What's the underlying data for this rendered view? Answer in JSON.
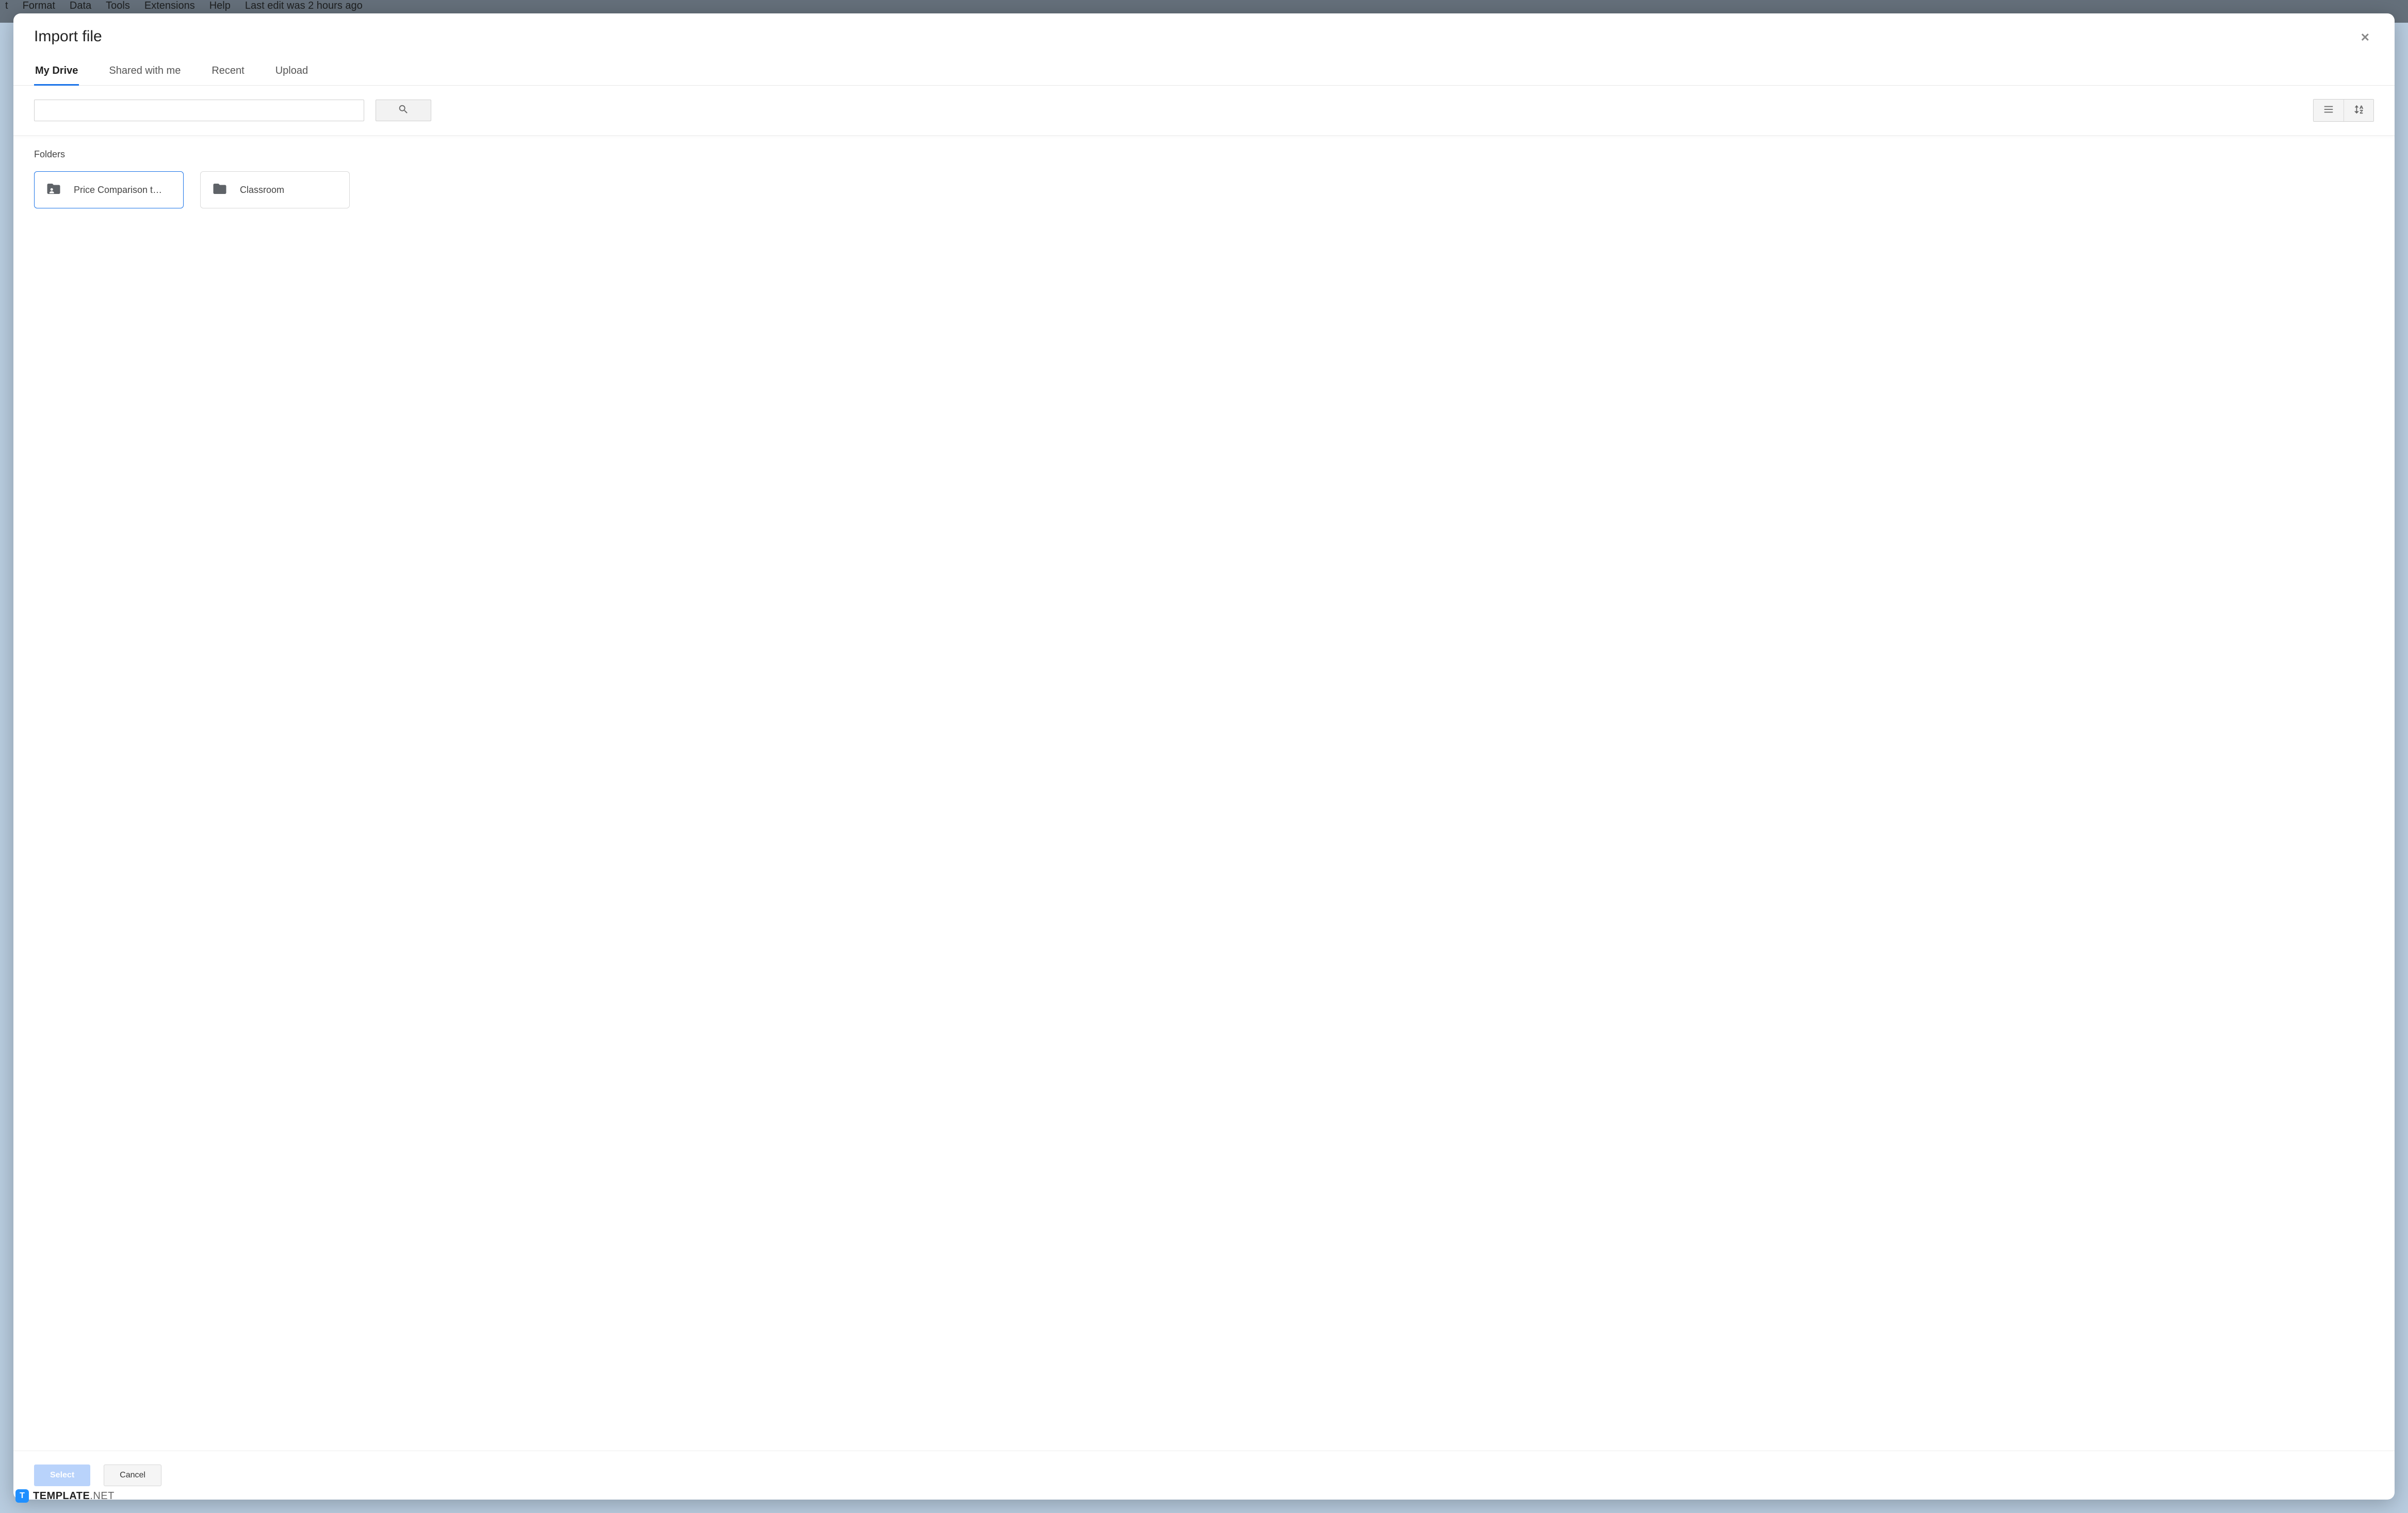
{
  "backdrop": {
    "menu": [
      "t",
      "Format",
      "Data",
      "Tools",
      "Extensions",
      "Help"
    ],
    "status": "Last edit was 2 hours ago"
  },
  "dialog": {
    "title": "Import file",
    "close_glyph": "✕"
  },
  "tabs": [
    {
      "label": "My Drive",
      "active": true
    },
    {
      "label": "Shared with me",
      "active": false
    },
    {
      "label": "Recent",
      "active": false
    },
    {
      "label": "Upload",
      "active": false
    }
  ],
  "search": {
    "value": "",
    "placeholder": ""
  },
  "view_toggle": {
    "list_label": "list-view",
    "sort_label": "sort-az"
  },
  "section_label": "Folders",
  "folders": [
    {
      "name": "Price Comparison t…",
      "selected": true,
      "shared": true
    },
    {
      "name": "Classroom",
      "selected": false,
      "shared": false
    }
  ],
  "footer": {
    "select_label": "Select",
    "cancel_label": "Cancel"
  },
  "watermark": {
    "icon_letter": "T",
    "brand": "TEMPLATE",
    "tld": ".NET"
  }
}
